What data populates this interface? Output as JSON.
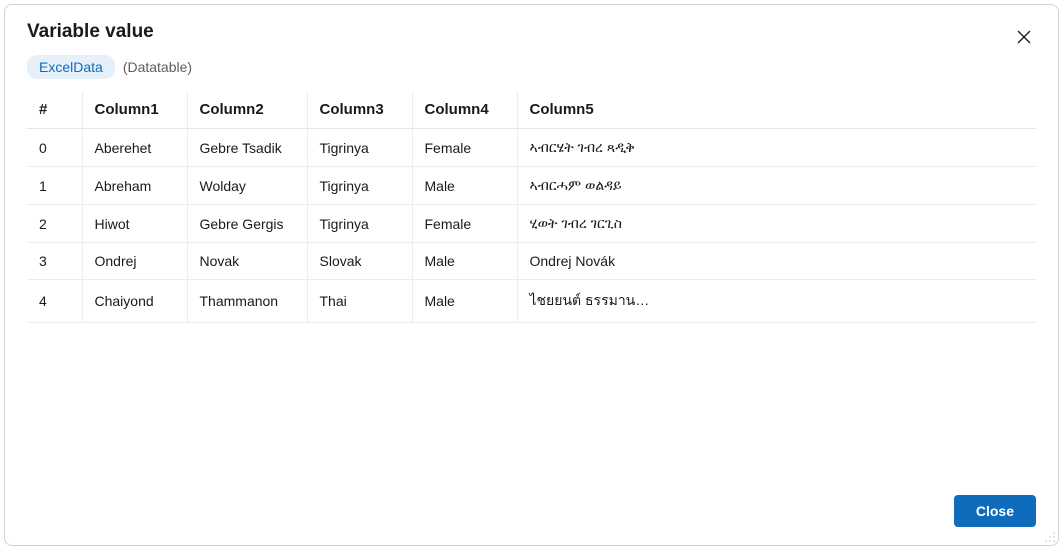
{
  "dialog": {
    "title": "Variable value",
    "variable_name": "ExcelData",
    "variable_type": "(Datatable)",
    "close_label": "Close"
  },
  "table": {
    "headers": {
      "index": "#",
      "c1": "Column1",
      "c2": "Column2",
      "c3": "Column3",
      "c4": "Column4",
      "c5": "Column5"
    },
    "rows": [
      {
        "index": "0",
        "c1": "Aberehet",
        "c2": "Gebre Tsadik",
        "c3": "Tigrinya",
        "c4": "Female",
        "c5": "ኣብርሄት ገብረ ጻዲቅ"
      },
      {
        "index": "1",
        "c1": "Abreham",
        "c2": "Wolday",
        "c3": "Tigrinya",
        "c4": "Male",
        "c5": "ኣብርሓም ወልዳይ"
      },
      {
        "index": "2",
        "c1": "Hiwot",
        "c2": "Gebre Gergis",
        "c3": "Tigrinya",
        "c4": "Female",
        "c5": "ሂወት ገብረ ገርጊስ"
      },
      {
        "index": "3",
        "c1": "Ondrej",
        "c2": "Novak",
        "c3": "Slovak",
        "c4": "Male",
        "c5": "Ondrej Novák"
      },
      {
        "index": "4",
        "c1": "Chaiyond",
        "c2": "Thammanon",
        "c3": "Thai",
        "c4": "Male",
        "c5": "ไชยยนต์ ธรรมานนท์"
      }
    ]
  },
  "chart_data": {
    "type": "table",
    "title": "Variable value — ExcelData (Datatable)",
    "columns": [
      "#",
      "Column1",
      "Column2",
      "Column3",
      "Column4",
      "Column5"
    ],
    "rows": [
      [
        "0",
        "Aberehet",
        "Gebre Tsadik",
        "Tigrinya",
        "Female",
        "ኣብርሄት ገብረ ጻዲቅ"
      ],
      [
        "1",
        "Abreham",
        "Wolday",
        "Tigrinya",
        "Male",
        "ኣብርሓም ወልዳይ"
      ],
      [
        "2",
        "Hiwot",
        "Gebre Gergis",
        "Tigrinya",
        "Female",
        "ሂወት ገብረ ገርጊስ"
      ],
      [
        "3",
        "Ondrej",
        "Novak",
        "Slovak",
        "Male",
        "Ondrej Novák"
      ],
      [
        "4",
        "Chaiyond",
        "Thammanon",
        "Thai",
        "Male",
        "ไชยยนต์ ธรรมานนท์"
      ]
    ]
  }
}
